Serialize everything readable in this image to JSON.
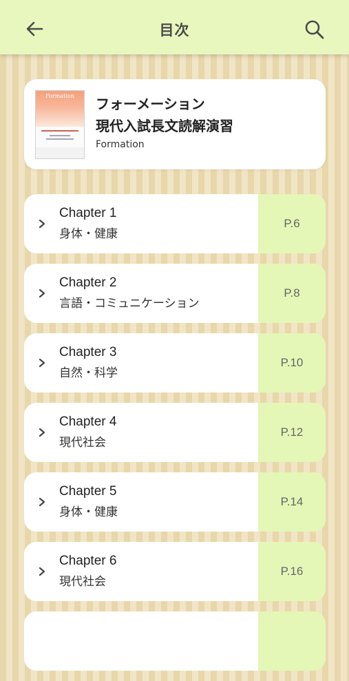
{
  "header": {
    "title": "目次",
    "back_icon": "back-arrow-icon",
    "search_icon": "search-icon"
  },
  "book": {
    "title_line1": "フォーメーション",
    "title_line2": "現代入試長文読解演習",
    "subtitle": "Formation",
    "cover_title": "Formation"
  },
  "chapters": [
    {
      "title": "Chapter 1",
      "subtitle": "身体・健康",
      "page": "P.6"
    },
    {
      "title": "Chapter 2",
      "subtitle": "言語・コミュニケーション",
      "page": "P.8"
    },
    {
      "title": "Chapter 3",
      "subtitle": "自然・科学",
      "page": "P.10"
    },
    {
      "title": "Chapter 4",
      "subtitle": "現代社会",
      "page": "P.12"
    },
    {
      "title": "Chapter 5",
      "subtitle": "身体・健康",
      "page": "P.14"
    },
    {
      "title": "Chapter 6",
      "subtitle": "現代社会",
      "page": "P.16"
    },
    {
      "title": "",
      "subtitle": "",
      "page": ""
    }
  ],
  "colors": {
    "header_bg": "#e8f7bd",
    "page_tab_bg": "#e4f7b6",
    "stripe_dark": "#e8d7ab",
    "stripe_light": "#f1e5c6"
  }
}
